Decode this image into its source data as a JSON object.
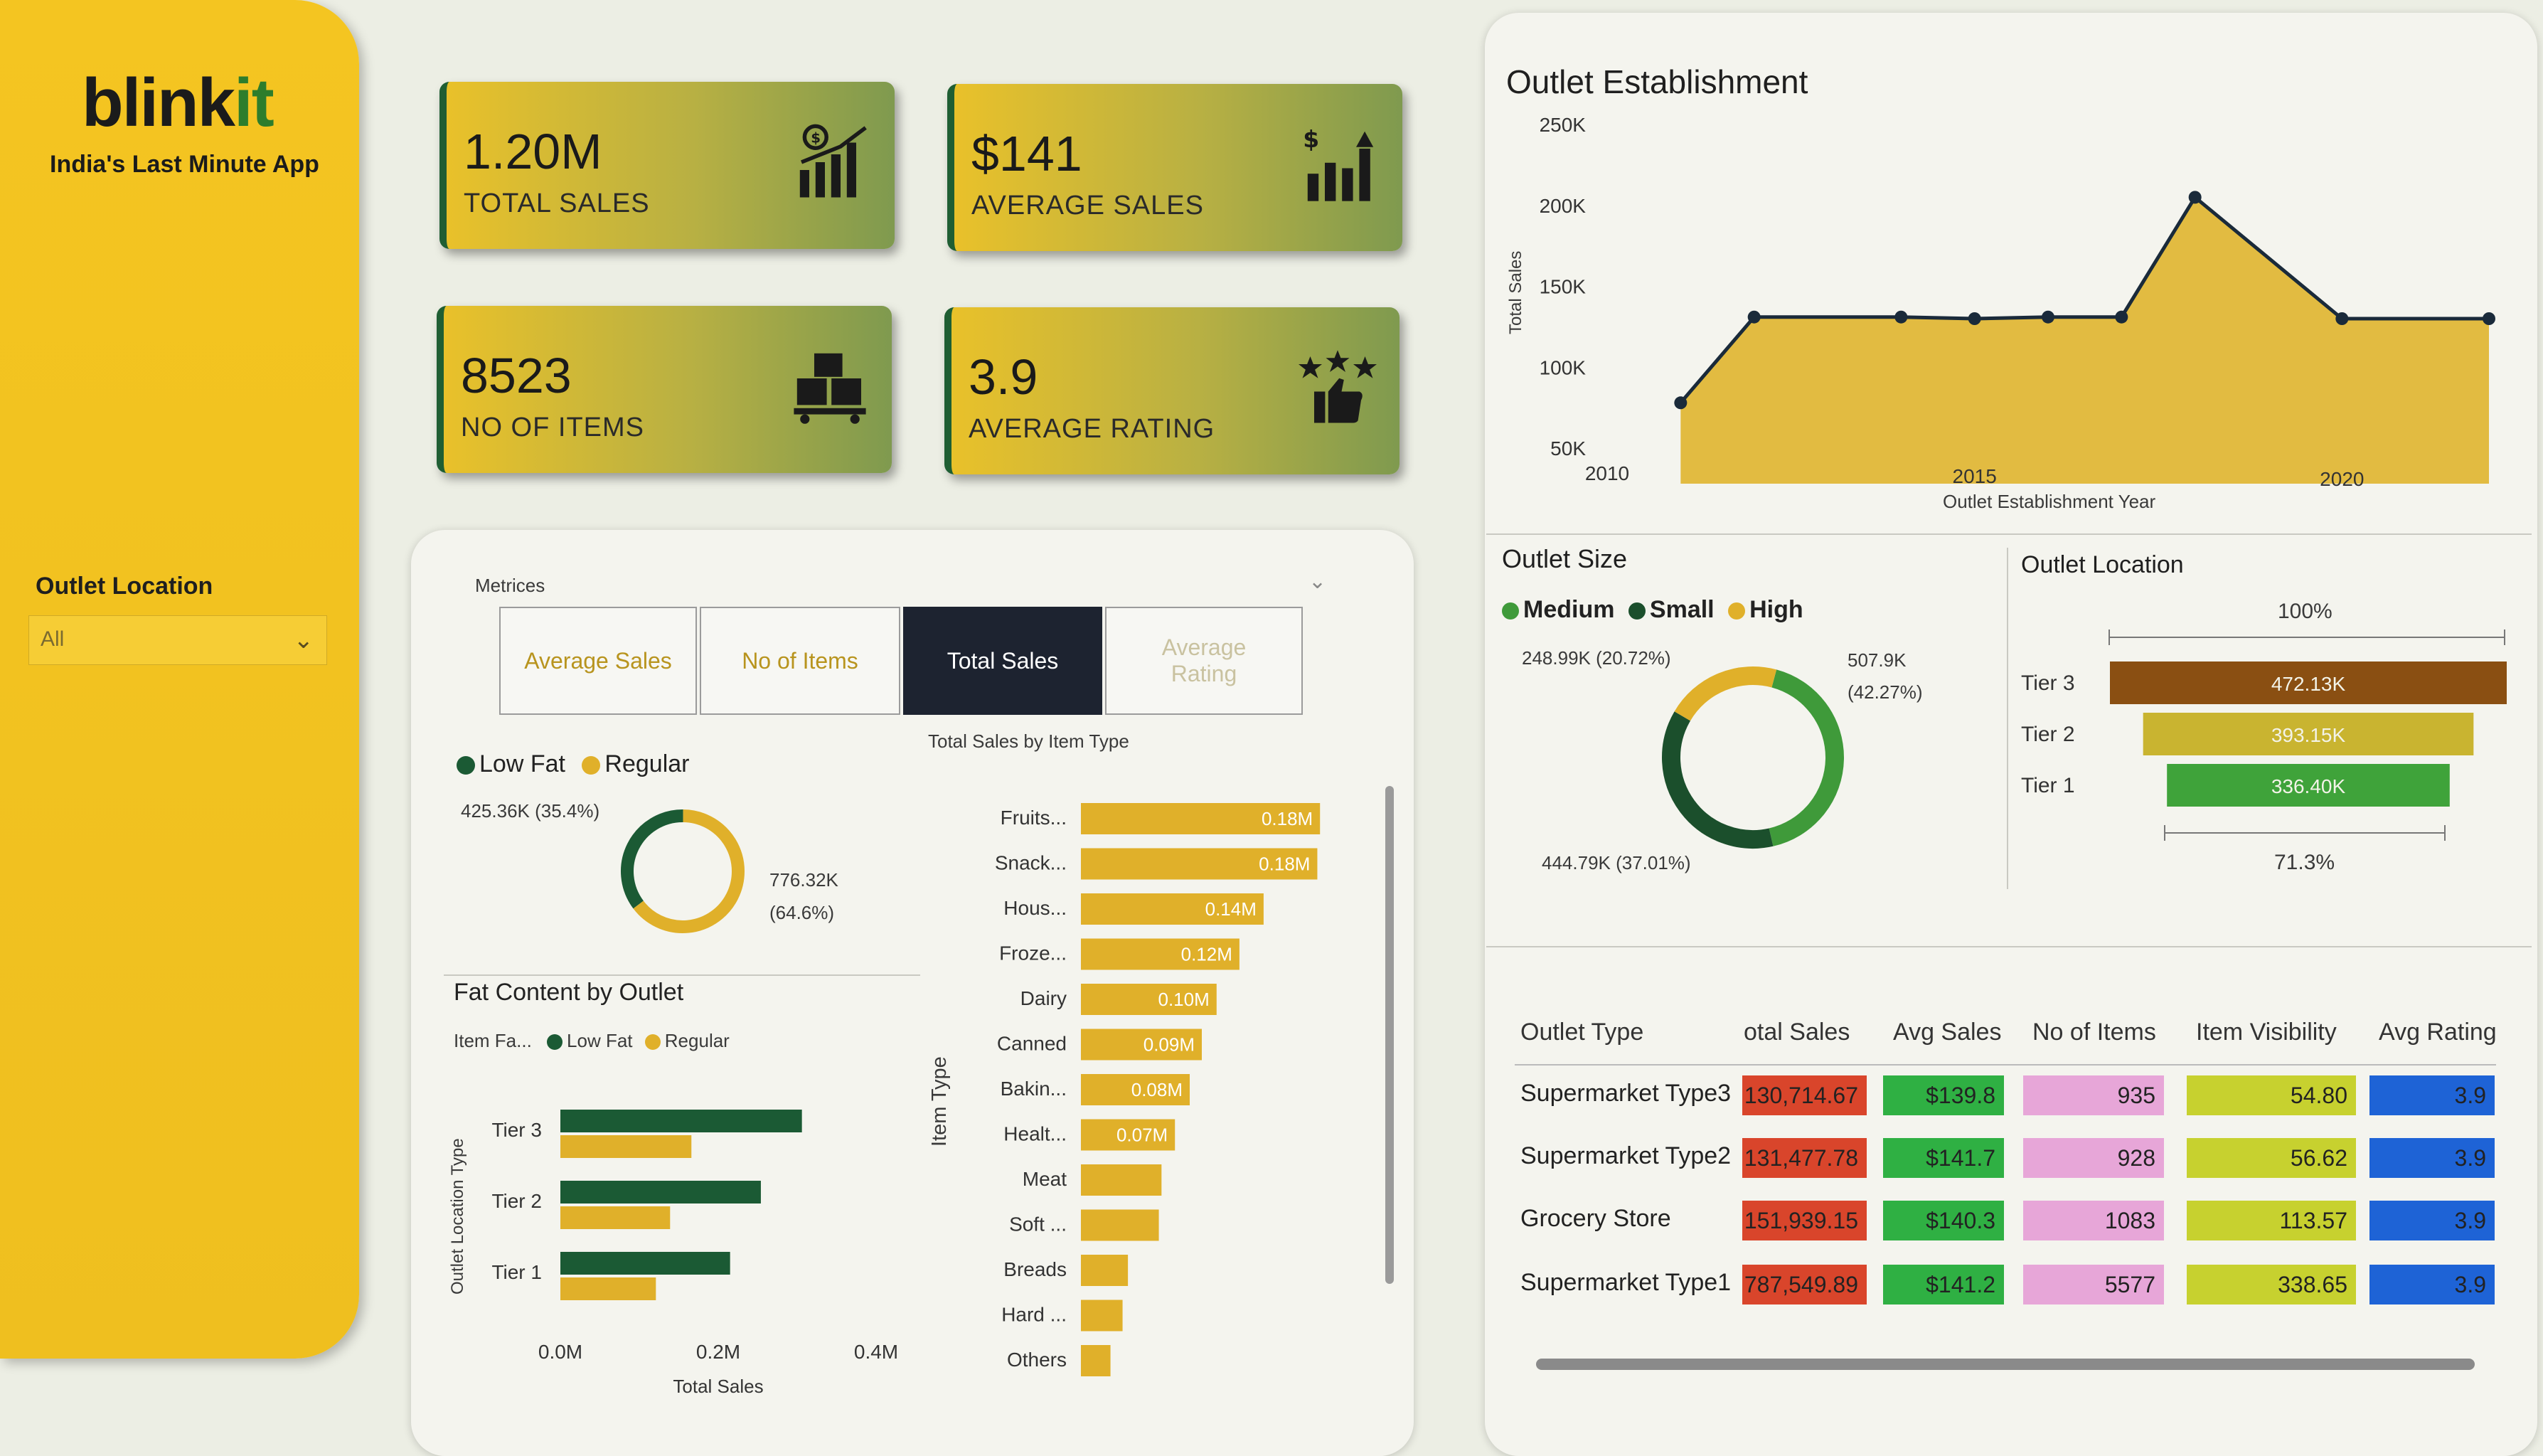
{
  "brand": {
    "name_main": "blink",
    "name_accent": "it",
    "tagline": "India's Last Minute App"
  },
  "filter": {
    "label": "Outlet Location",
    "value": "All"
  },
  "kpis": [
    {
      "value": "1.20M",
      "label": "TOTAL SALES",
      "icon": "bar-chart-dollar-icon"
    },
    {
      "value": "$141",
      "label": "AVERAGE SALES",
      "icon": "bar-chart-up-icon"
    },
    {
      "value": "8523",
      "label": "NO OF ITEMS",
      "icon": "boxes-cart-icon"
    },
    {
      "value": "3.9",
      "label": "AVERAGE RATING",
      "icon": "thumbs-up-stars-icon"
    }
  ],
  "metrics_slicer": {
    "title": "Metrices",
    "options": [
      "Average Sales",
      "No of Items",
      "Total Sales",
      "Average Rating"
    ],
    "selected": "Total Sales"
  },
  "fat_donut": {
    "legend": [
      "Low Fat",
      "Regular"
    ],
    "label_left": "425.36K (35.4%)",
    "label_right_1": "776.32K",
    "label_right_2": "(64.6%)",
    "values": [
      425.36,
      776.32
    ],
    "colors": [
      "#1b5a34",
      "#e0b02a"
    ]
  },
  "fat_by_outlet": {
    "title": "Fat Content by Outlet",
    "legend_title": "Item Fa...",
    "legend": [
      "Low Fat",
      "Regular"
    ],
    "yaxis_label": "Outlet Location Type",
    "xaxis_label": "Total Sales",
    "xticks": [
      "0.0M",
      "0.2M",
      "0.4M"
    ],
    "chart_data": {
      "type": "bar",
      "categories": [
        "Tier 3",
        "Tier 2",
        "Tier 1"
      ],
      "series": [
        {
          "name": "Low Fat",
          "values": [
            0.306,
            0.254,
            0.215
          ]
        },
        {
          "name": "Regular",
          "values": [
            0.166,
            0.139,
            0.121
          ]
        }
      ],
      "xlim": [
        0,
        0.4
      ]
    }
  },
  "item_type": {
    "title": "Total Sales by Item Type",
    "yaxis_label": "Item Type",
    "chart_data": {
      "type": "bar",
      "categories": [
        "Fruits...",
        "Snack...",
        "Hous...",
        "Froze...",
        "Dairy",
        "Canned",
        "Bakin...",
        "Healt...",
        "Meat",
        "Soft ...",
        "Breads",
        "Hard ...",
        "Others"
      ],
      "values": [
        0.178,
        0.176,
        0.136,
        0.118,
        0.101,
        0.09,
        0.081,
        0.07,
        0.06,
        0.058,
        0.035,
        0.031,
        0.022
      ],
      "labels": [
        "0.18M",
        "0.18M",
        "0.14M",
        "0.12M",
        "0.10M",
        "0.09M",
        "0.08M",
        "0.07M",
        "",
        "",
        "",
        "",
        ""
      ]
    }
  },
  "establishment": {
    "title": "Outlet Establishment",
    "yaxis_label": "Total Sales",
    "xaxis_label": "Outlet Establishment Year",
    "yticks": [
      "250K",
      "200K",
      "150K",
      "100K",
      "50K"
    ],
    "xticks": [
      "2010",
      "2015",
      "2020"
    ],
    "chart_data": {
      "type": "area",
      "x": [
        2011,
        2012,
        2014,
        2015,
        2016,
        2017,
        2018,
        2020,
        2022
      ],
      "y": [
        78,
        131,
        131,
        130,
        131,
        131,
        205,
        130,
        130
      ],
      "xlim": [
        2010,
        2022
      ],
      "ylim": [
        50,
        250
      ]
    }
  },
  "outlet_size": {
    "title": "Outlet Size",
    "legend": [
      "Medium",
      "Small",
      "High"
    ],
    "label_left": "248.99K (20.72%)",
    "label_right_1": "507.9K",
    "label_right_2": "(42.27%)",
    "label_bottom": "444.79K (37.01%)",
    "values": [
      507.9,
      444.79,
      248.99
    ],
    "colors": [
      "#3f9a3a",
      "#1b4f2c",
      "#e0b02a"
    ]
  },
  "outlet_location": {
    "title": "Outlet Location",
    "top_label": "100%",
    "bottom_label": "71.3%",
    "chart_data": {
      "type": "bar",
      "categories": [
        "Tier 3",
        "Tier 2",
        "Tier 1"
      ],
      "values": [
        472.13,
        393.15,
        336.4
      ],
      "labels": [
        "472.13K",
        "393.15K",
        "336.40K"
      ]
    },
    "colors": [
      "#8a4f12",
      "#c9b430",
      "#3fa33a"
    ]
  },
  "outlet_table": {
    "headers": [
      "Outlet Type",
      "otal Sales",
      "Avg Sales",
      "No of Items",
      "Item Visibility",
      "Avg Rating"
    ],
    "rows": [
      {
        "type": "Supermarket Type3",
        "total": "130,714.67",
        "avg": "$139.8",
        "items": "935",
        "vis": "54.80",
        "rating": "3.9"
      },
      {
        "type": "Supermarket Type2",
        "total": "131,477.78",
        "avg": "$141.7",
        "items": "928",
        "vis": "56.62",
        "rating": "3.9"
      },
      {
        "type": "Grocery Store",
        "total": "151,939.15",
        "avg": "$140.3",
        "items": "1083",
        "vis": "113.57",
        "rating": "3.9"
      },
      {
        "type": "Supermarket Type1",
        "total": "787,549.89",
        "avg": "$141.2",
        "items": "5577",
        "vis": "338.65",
        "rating": "3.9"
      }
    ],
    "colors": {
      "total": "#d9452b",
      "avg": "#2fb043",
      "items": "#e7a6d8",
      "vis": "#c7d12f",
      "rating": "#1e63d6"
    }
  }
}
